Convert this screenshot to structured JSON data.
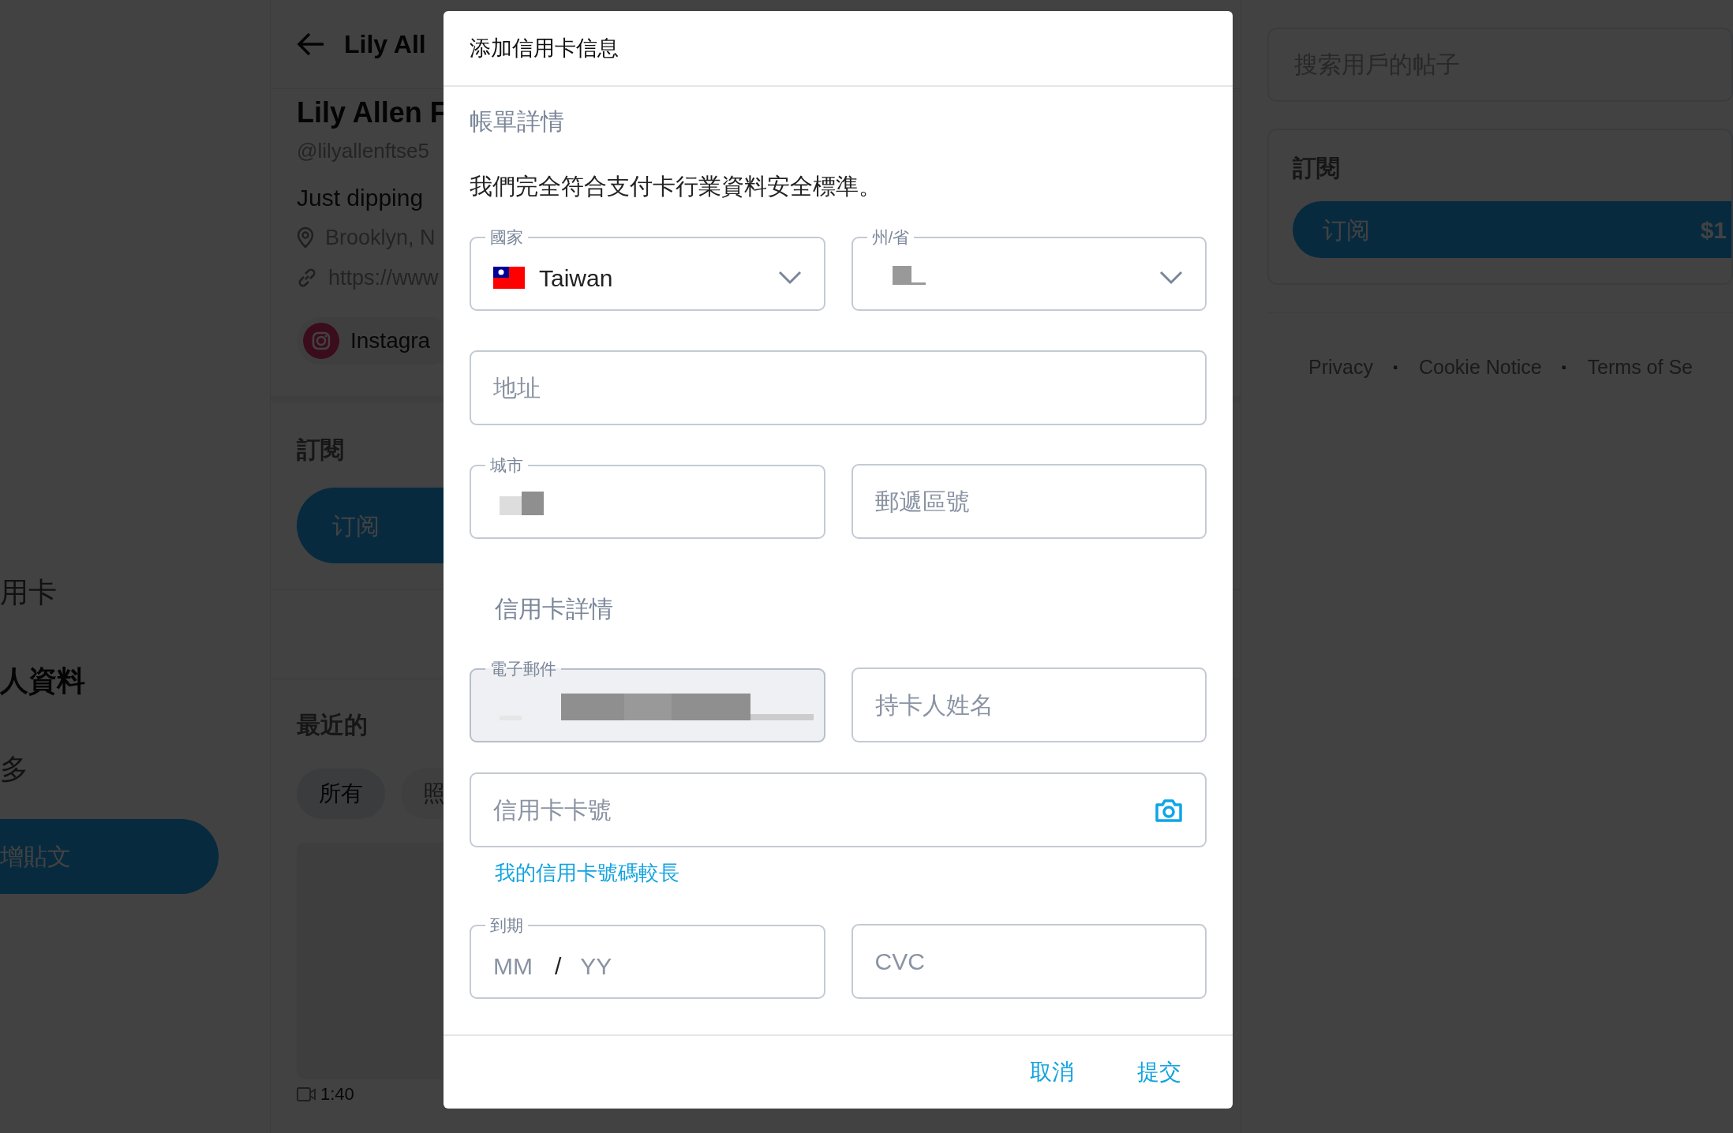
{
  "sidebar": {
    "items": [
      {
        "label": "用卡",
        "selected": false
      },
      {
        "label": "人資料",
        "selected": true
      },
      {
        "label": "多",
        "selected": false
      }
    ],
    "new_post_button": "增貼文"
  },
  "profile": {
    "header_title": "Lily All",
    "name": "Lily Allen F",
    "handle": "@lilyallenftse5",
    "bio": "Just dipping",
    "location": "Brooklyn, N",
    "website": "https://www",
    "social_chip": "Instagra",
    "subscription": {
      "heading": "訂閱",
      "button": "订阅"
    },
    "recent": {
      "heading": "最近的",
      "filters": [
        {
          "label": "所有",
          "selected": true
        },
        {
          "label": "照",
          "selected": false
        }
      ]
    },
    "post_duration": "1:40"
  },
  "right_panel": {
    "search": {
      "placeholder": "搜索用戶的帖子"
    },
    "subscription": {
      "heading": "訂閱",
      "button": "订阅",
      "price": "$1"
    },
    "footer": [
      {
        "kind": "link",
        "text": "Privacy"
      },
      {
        "kind": "separator",
        "text": "·"
      },
      {
        "kind": "link",
        "text": "Cookie Notice"
      },
      {
        "kind": "separator",
        "text": "·"
      },
      {
        "kind": "link",
        "text": "Terms of Se"
      }
    ]
  },
  "dialog": {
    "title": "添加信用卡信息",
    "billing_heading": "帳單詳情",
    "notice": "我們完全符合支付卡行業資料安全標準。",
    "billing_rows": [
      [
        {
          "kind": "country",
          "label": "國家",
          "value": "Taiwan"
        },
        {
          "kind": "select",
          "label": "州/省",
          "redacted": true
        }
      ],
      [
        {
          "kind": "input",
          "placeholder": "地址",
          "disabled": false
        }
      ],
      [
        {
          "kind": "input",
          "label": "城市",
          "redacted": true,
          "disabled": false
        },
        {
          "kind": "input",
          "placeholder": "郵遞區號",
          "disabled": false
        }
      ]
    ],
    "card_heading": "信用卡詳情",
    "card_rows": [
      [
        {
          "kind": "input",
          "label": "電子郵件",
          "redacted": true,
          "disabled": true
        },
        {
          "kind": "input",
          "placeholder": "持卡人姓名",
          "disabled": false
        }
      ],
      [
        {
          "kind": "input",
          "placeholder": "信用卡卡號",
          "camera": true,
          "disabled": false
        }
      ],
      [
        {
          "kind": "link",
          "text": "我的信用卡號碼較長"
        }
      ],
      [
        {
          "kind": "expiry",
          "label": "到期",
          "month_placeholder": "MM",
          "separator": "/",
          "year_placeholder": "YY"
        },
        {
          "kind": "input",
          "placeholder": "CVC",
          "disabled": false
        }
      ]
    ],
    "actions": [
      "取消",
      "提交"
    ]
  }
}
